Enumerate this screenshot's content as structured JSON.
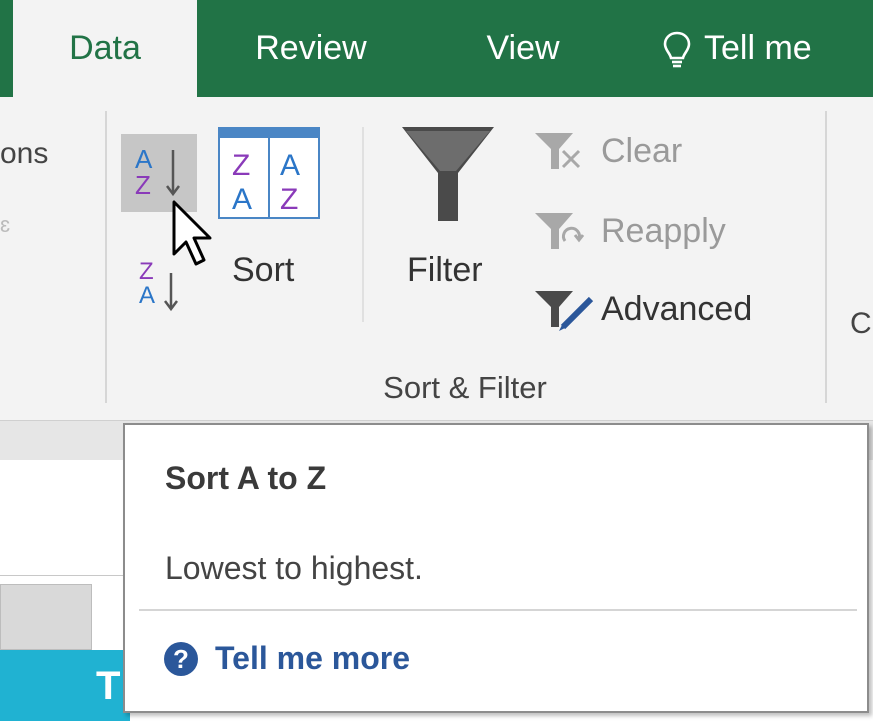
{
  "tabs": [
    {
      "label": "Data",
      "active": true
    },
    {
      "label": "Review",
      "active": false
    },
    {
      "label": "View",
      "active": false
    }
  ],
  "tell_me": {
    "label": "Tell me",
    "icon": "lightbulb-icon"
  },
  "ribbon": {
    "left_cutoff_label": "ons",
    "sort_ascending": {
      "icon": "sort-a-to-z-icon",
      "letters_top": "A",
      "letters_bottom": "Z"
    },
    "sort_descending": {
      "icon": "sort-z-to-a-icon",
      "letters_top": "Z",
      "letters_bottom": "A"
    },
    "sort": {
      "label": "Sort",
      "icon": "sort-dialog-icon"
    },
    "filter": {
      "label": "Filter",
      "icon": "funnel-icon"
    },
    "clear": {
      "label": "Clear",
      "enabled": false
    },
    "reapply": {
      "label": "Reapply",
      "enabled": false
    },
    "advanced": {
      "label": "Advanced",
      "enabled": true
    },
    "group_label": "Sort & Filter",
    "right_cutoff_label": "C"
  },
  "tooltip": {
    "title": "Sort A to Z",
    "description": "Lowest to highest.",
    "help_label": "Tell me more",
    "help_icon": "question-circle-icon"
  },
  "sheet": {
    "cutoff_text": "T"
  },
  "colors": {
    "accent": "#217346",
    "ribbon_bg": "#f3f3f3",
    "sort_blue": "#2b76c8",
    "sort_purple": "#8a3ab9",
    "help_blue": "#2b579a",
    "teal": "#20b2d2"
  }
}
